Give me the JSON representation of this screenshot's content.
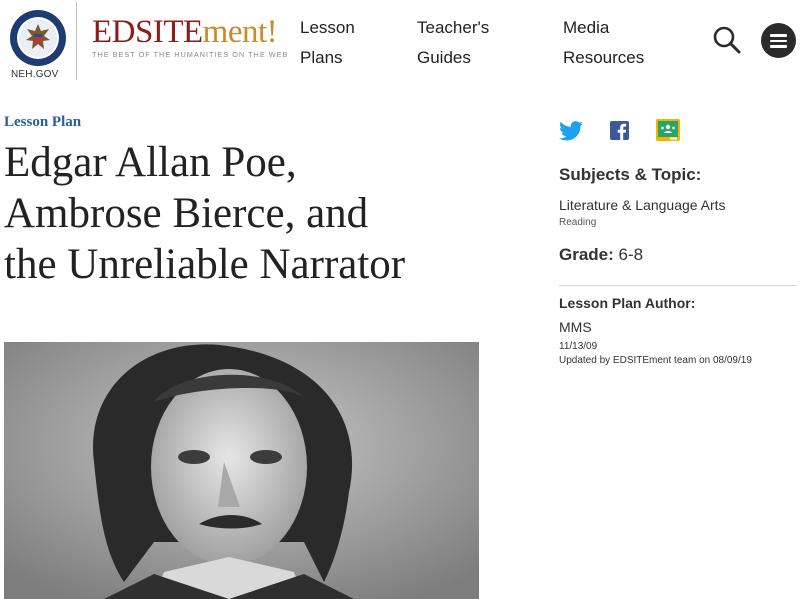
{
  "header": {
    "seal_label": "NEH.GOV",
    "brand_main": "EDSITE",
    "brand_accent": "ment!",
    "tagline": "THE BEST OF THE HUMANITIES ON THE WEB",
    "nav": [
      {
        "line1": "Lesson",
        "line2": "Plans"
      },
      {
        "line1": "Teacher's",
        "line2": "Guides"
      },
      {
        "line1": "Media",
        "line2": "Resources"
      }
    ]
  },
  "main": {
    "label": "Lesson Plan",
    "title_lines": [
      "Edgar Allan Poe,",
      "Ambrose Bierce, and",
      "the Unreliable Narrator"
    ]
  },
  "sidebar": {
    "subjects_heading": "Subjects & Topic:",
    "subject": "Literature & Language Arts",
    "topic": "Reading",
    "grade_label": "Grade:",
    "grade_value": "6-8",
    "author_heading": "Lesson Plan Author:",
    "author": "MMS",
    "date": "11/13/09",
    "updated": "Updated by EDSITEment team on 08/09/19"
  },
  "icons": {
    "twitter": "twitter-icon",
    "facebook": "facebook-icon",
    "classroom": "google-classroom-icon",
    "search": "search-icon",
    "menu": "hamburger-menu-icon"
  },
  "colors": {
    "brand_red": "#8a1e1b",
    "brand_gold": "#c98b2b",
    "label_blue": "#2a5d9f",
    "twitter_blue": "#1da1f2",
    "facebook_blue": "#3b5998",
    "classroom_green": "#25a667"
  }
}
